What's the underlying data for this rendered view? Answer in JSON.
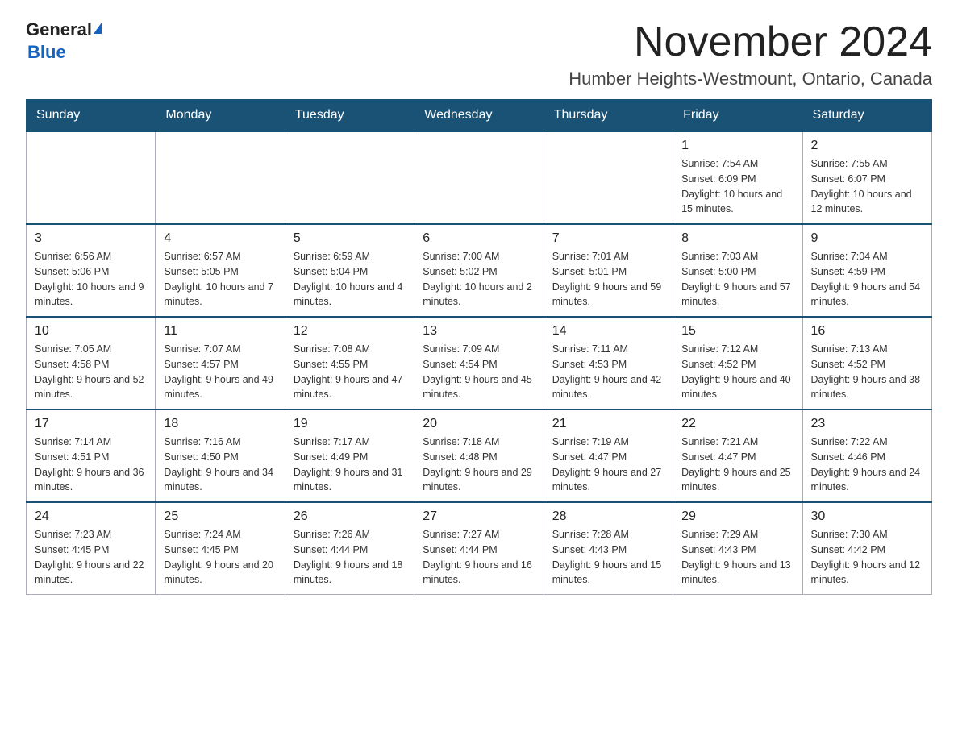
{
  "header": {
    "logo_general": "General",
    "logo_blue": "Blue",
    "month_title": "November 2024",
    "location": "Humber Heights-Westmount, Ontario, Canada"
  },
  "weekdays": [
    "Sunday",
    "Monday",
    "Tuesday",
    "Wednesday",
    "Thursday",
    "Friday",
    "Saturday"
  ],
  "weeks": [
    [
      {
        "day": "",
        "sunrise": "",
        "sunset": "",
        "daylight": ""
      },
      {
        "day": "",
        "sunrise": "",
        "sunset": "",
        "daylight": ""
      },
      {
        "day": "",
        "sunrise": "",
        "sunset": "",
        "daylight": ""
      },
      {
        "day": "",
        "sunrise": "",
        "sunset": "",
        "daylight": ""
      },
      {
        "day": "",
        "sunrise": "",
        "sunset": "",
        "daylight": ""
      },
      {
        "day": "1",
        "sunrise": "Sunrise: 7:54 AM",
        "sunset": "Sunset: 6:09 PM",
        "daylight": "Daylight: 10 hours and 15 minutes."
      },
      {
        "day": "2",
        "sunrise": "Sunrise: 7:55 AM",
        "sunset": "Sunset: 6:07 PM",
        "daylight": "Daylight: 10 hours and 12 minutes."
      }
    ],
    [
      {
        "day": "3",
        "sunrise": "Sunrise: 6:56 AM",
        "sunset": "Sunset: 5:06 PM",
        "daylight": "Daylight: 10 hours and 9 minutes."
      },
      {
        "day": "4",
        "sunrise": "Sunrise: 6:57 AM",
        "sunset": "Sunset: 5:05 PM",
        "daylight": "Daylight: 10 hours and 7 minutes."
      },
      {
        "day": "5",
        "sunrise": "Sunrise: 6:59 AM",
        "sunset": "Sunset: 5:04 PM",
        "daylight": "Daylight: 10 hours and 4 minutes."
      },
      {
        "day": "6",
        "sunrise": "Sunrise: 7:00 AM",
        "sunset": "Sunset: 5:02 PM",
        "daylight": "Daylight: 10 hours and 2 minutes."
      },
      {
        "day": "7",
        "sunrise": "Sunrise: 7:01 AM",
        "sunset": "Sunset: 5:01 PM",
        "daylight": "Daylight: 9 hours and 59 minutes."
      },
      {
        "day": "8",
        "sunrise": "Sunrise: 7:03 AM",
        "sunset": "Sunset: 5:00 PM",
        "daylight": "Daylight: 9 hours and 57 minutes."
      },
      {
        "day": "9",
        "sunrise": "Sunrise: 7:04 AM",
        "sunset": "Sunset: 4:59 PM",
        "daylight": "Daylight: 9 hours and 54 minutes."
      }
    ],
    [
      {
        "day": "10",
        "sunrise": "Sunrise: 7:05 AM",
        "sunset": "Sunset: 4:58 PM",
        "daylight": "Daylight: 9 hours and 52 minutes."
      },
      {
        "day": "11",
        "sunrise": "Sunrise: 7:07 AM",
        "sunset": "Sunset: 4:57 PM",
        "daylight": "Daylight: 9 hours and 49 minutes."
      },
      {
        "day": "12",
        "sunrise": "Sunrise: 7:08 AM",
        "sunset": "Sunset: 4:55 PM",
        "daylight": "Daylight: 9 hours and 47 minutes."
      },
      {
        "day": "13",
        "sunrise": "Sunrise: 7:09 AM",
        "sunset": "Sunset: 4:54 PM",
        "daylight": "Daylight: 9 hours and 45 minutes."
      },
      {
        "day": "14",
        "sunrise": "Sunrise: 7:11 AM",
        "sunset": "Sunset: 4:53 PM",
        "daylight": "Daylight: 9 hours and 42 minutes."
      },
      {
        "day": "15",
        "sunrise": "Sunrise: 7:12 AM",
        "sunset": "Sunset: 4:52 PM",
        "daylight": "Daylight: 9 hours and 40 minutes."
      },
      {
        "day": "16",
        "sunrise": "Sunrise: 7:13 AM",
        "sunset": "Sunset: 4:52 PM",
        "daylight": "Daylight: 9 hours and 38 minutes."
      }
    ],
    [
      {
        "day": "17",
        "sunrise": "Sunrise: 7:14 AM",
        "sunset": "Sunset: 4:51 PM",
        "daylight": "Daylight: 9 hours and 36 minutes."
      },
      {
        "day": "18",
        "sunrise": "Sunrise: 7:16 AM",
        "sunset": "Sunset: 4:50 PM",
        "daylight": "Daylight: 9 hours and 34 minutes."
      },
      {
        "day": "19",
        "sunrise": "Sunrise: 7:17 AM",
        "sunset": "Sunset: 4:49 PM",
        "daylight": "Daylight: 9 hours and 31 minutes."
      },
      {
        "day": "20",
        "sunrise": "Sunrise: 7:18 AM",
        "sunset": "Sunset: 4:48 PM",
        "daylight": "Daylight: 9 hours and 29 minutes."
      },
      {
        "day": "21",
        "sunrise": "Sunrise: 7:19 AM",
        "sunset": "Sunset: 4:47 PM",
        "daylight": "Daylight: 9 hours and 27 minutes."
      },
      {
        "day": "22",
        "sunrise": "Sunrise: 7:21 AM",
        "sunset": "Sunset: 4:47 PM",
        "daylight": "Daylight: 9 hours and 25 minutes."
      },
      {
        "day": "23",
        "sunrise": "Sunrise: 7:22 AM",
        "sunset": "Sunset: 4:46 PM",
        "daylight": "Daylight: 9 hours and 24 minutes."
      }
    ],
    [
      {
        "day": "24",
        "sunrise": "Sunrise: 7:23 AM",
        "sunset": "Sunset: 4:45 PM",
        "daylight": "Daylight: 9 hours and 22 minutes."
      },
      {
        "day": "25",
        "sunrise": "Sunrise: 7:24 AM",
        "sunset": "Sunset: 4:45 PM",
        "daylight": "Daylight: 9 hours and 20 minutes."
      },
      {
        "day": "26",
        "sunrise": "Sunrise: 7:26 AM",
        "sunset": "Sunset: 4:44 PM",
        "daylight": "Daylight: 9 hours and 18 minutes."
      },
      {
        "day": "27",
        "sunrise": "Sunrise: 7:27 AM",
        "sunset": "Sunset: 4:44 PM",
        "daylight": "Daylight: 9 hours and 16 minutes."
      },
      {
        "day": "28",
        "sunrise": "Sunrise: 7:28 AM",
        "sunset": "Sunset: 4:43 PM",
        "daylight": "Daylight: 9 hours and 15 minutes."
      },
      {
        "day": "29",
        "sunrise": "Sunrise: 7:29 AM",
        "sunset": "Sunset: 4:43 PM",
        "daylight": "Daylight: 9 hours and 13 minutes."
      },
      {
        "day": "30",
        "sunrise": "Sunrise: 7:30 AM",
        "sunset": "Sunset: 4:42 PM",
        "daylight": "Daylight: 9 hours and 12 minutes."
      }
    ]
  ]
}
